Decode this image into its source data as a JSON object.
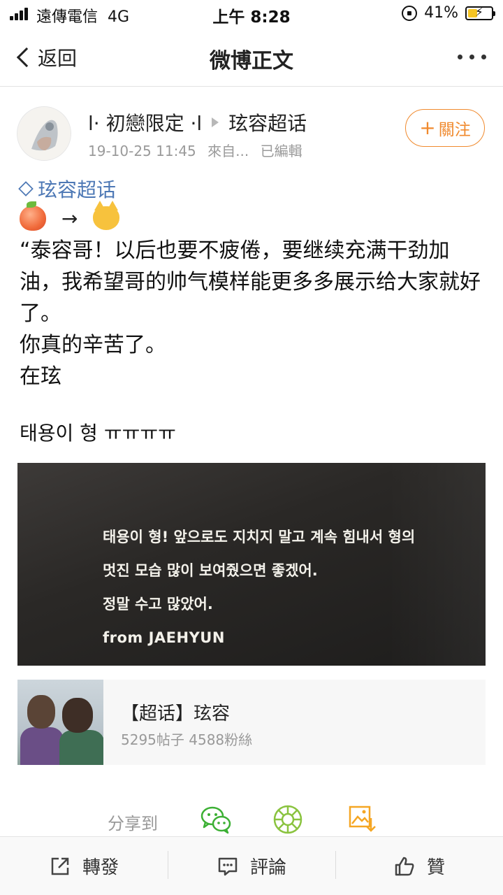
{
  "status_bar": {
    "carrier": "遠傳電信",
    "network": "4G",
    "time": "上午 8:28",
    "battery": "41%",
    "battery_level": 0.41
  },
  "nav": {
    "back_label": "返回",
    "title": "微博正文"
  },
  "author": {
    "name": "l· 初戀限定 ·l",
    "topic": "玹容超话",
    "timestamp": "19-10-25 11:45",
    "source": "來自...",
    "edited": "已編輯",
    "follow_label": "關注",
    "follow_plus": "+"
  },
  "post": {
    "topic_tag": "玹容超话",
    "arrow": "→",
    "lines": [
      "“泰容哥！以后也要不疲倦，要继续充满干劲加油，我希望哥的帅气模样能更多多展示给大家就好了。",
      "你真的辛苦了。",
      "在玹"
    ],
    "korean_line": "태용이 형 ㅠㅠㅠㅠ",
    "image_text": {
      "line1": "태용이 형! 앞으로도 지치지 말고 계속 힘내서 형의",
      "line2": "멋진 모습 많이 보여줬으면 좋겠어.",
      "line3": "정말 수고 많았어.",
      "from": "from JAEHYUN"
    }
  },
  "topic_card": {
    "title": "【超话】玹容",
    "stats": "5295帖子 4588粉絲"
  },
  "share": {
    "label": "分享到"
  },
  "toolbar": {
    "repost": "轉發",
    "comment": "評論",
    "like": "贊"
  },
  "colors": {
    "accent_orange": "#f08a2e",
    "link_blue": "#4d78b5",
    "wechat_green": "#3cb034",
    "moments_green": "#8ac33f",
    "save_orange": "#f5a623"
  }
}
